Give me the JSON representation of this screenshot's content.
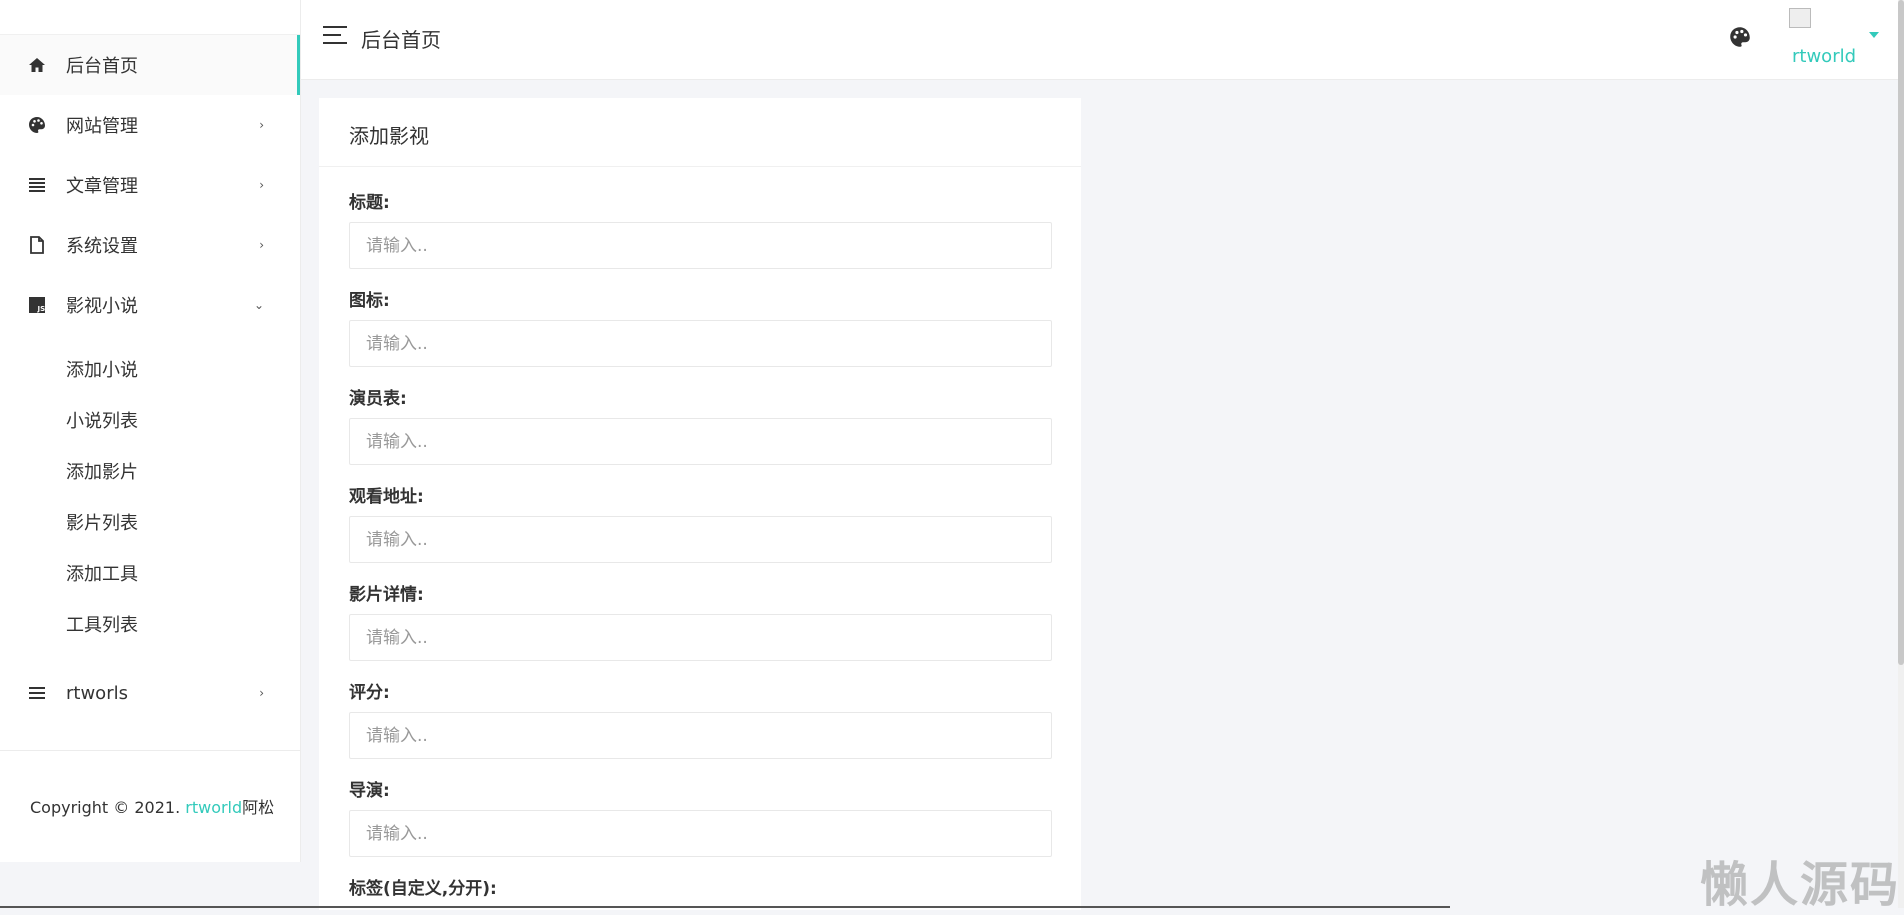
{
  "sidebar": {
    "items": [
      {
        "label": "后台首页",
        "icon": "home-icon"
      },
      {
        "label": "网站管理",
        "icon": "palette-icon",
        "chevron": "›"
      },
      {
        "label": "文章管理",
        "icon": "list-icon",
        "chevron": "›"
      },
      {
        "label": "系统设置",
        "icon": "file-icon",
        "chevron": "›"
      },
      {
        "label": "影视小说",
        "icon": "js-icon",
        "chevron": "⌄"
      }
    ],
    "submenu": [
      "添加小说",
      "小说列表",
      "添加影片",
      "影片列表",
      "添加工具",
      "工具列表"
    ],
    "extra": {
      "label": "rtworls",
      "icon": "menu-icon",
      "chevron": "›"
    },
    "footer": {
      "prefix": "Copyright © 2021. ",
      "brand": "rtworld",
      "suffix": "阿松"
    }
  },
  "header": {
    "title": "后台首页",
    "username": "rtworld"
  },
  "card": {
    "title": "添加影视",
    "fields": [
      {
        "label": "标题:",
        "placeholder": "请输入.."
      },
      {
        "label": "图标:",
        "placeholder": "请输入.."
      },
      {
        "label": "演员表:",
        "placeholder": "请输入.."
      },
      {
        "label": "观看地址:",
        "placeholder": "请输入.."
      },
      {
        "label": "影片详情:",
        "placeholder": "请输入.."
      },
      {
        "label": "评分:",
        "placeholder": "请输入.."
      },
      {
        "label": "导演:",
        "placeholder": "请输入.."
      },
      {
        "label": "标签(自定义,分开):",
        "placeholder": ""
      }
    ]
  },
  "watermark": "懒人源码",
  "colors": {
    "accent": "#33cabb",
    "background": "#f4f5f8"
  }
}
